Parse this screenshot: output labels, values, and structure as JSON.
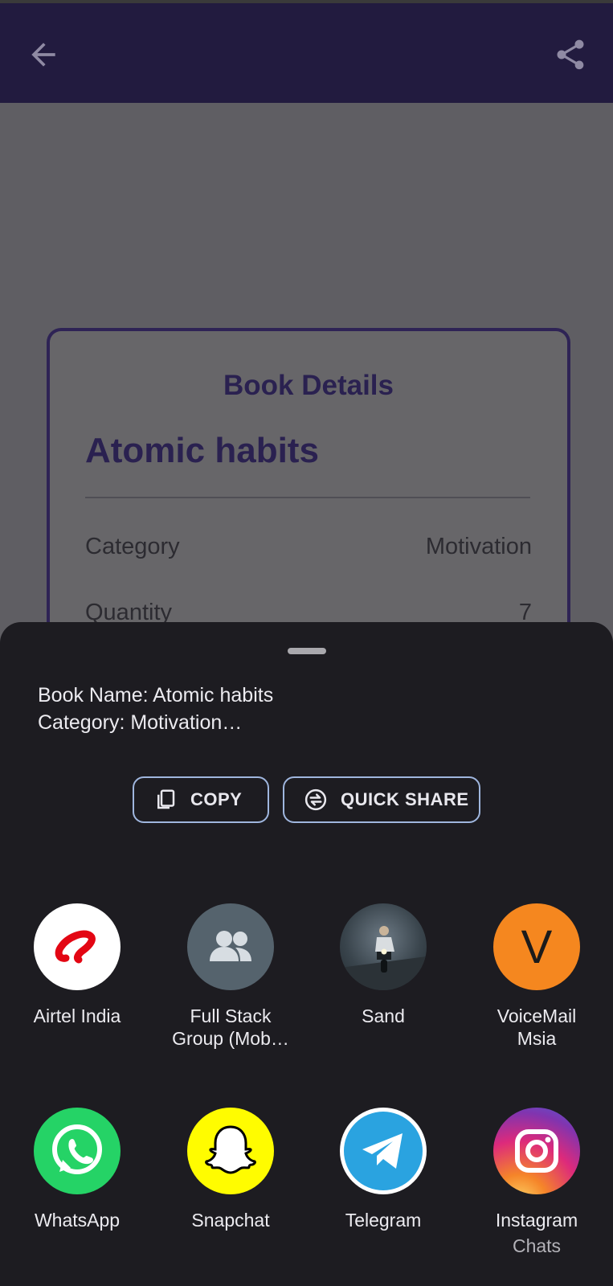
{
  "app_bar": {
    "back_icon": "arrow-back-icon",
    "share_icon": "share-icon"
  },
  "card": {
    "title": "Book Details",
    "book_name": "Atomic habits",
    "rows": [
      {
        "label": "Category",
        "value": "Motivation"
      },
      {
        "label": "Quantity",
        "value": "7"
      }
    ]
  },
  "share_sheet": {
    "preview_lines": [
      "Book Name: Atomic habits",
      "Category: Motivation…"
    ],
    "copy_label": "COPY",
    "quick_share_label": "QUICK SHARE",
    "contacts": [
      {
        "line1": "Airtel India",
        "line2": ""
      },
      {
        "line1": "Full Stack",
        "line2": "Group (Mob…"
      },
      {
        "line1": "Sand",
        "line2": ""
      },
      {
        "line1": "VoiceMail",
        "line2": "Msia",
        "avatar_letter": "V"
      }
    ],
    "apps": [
      {
        "label": "WhatsApp"
      },
      {
        "label": "Snapchat"
      },
      {
        "label": "Telegram"
      },
      {
        "label": "Instagram",
        "sub": "Chats"
      }
    ]
  },
  "colors": {
    "app_bar": "#221b3f",
    "scrim": "#5f5e63",
    "sheet": "#1d1c21",
    "accent_outline": "#9fb6de",
    "voicemail_orange": "#f5871f"
  }
}
